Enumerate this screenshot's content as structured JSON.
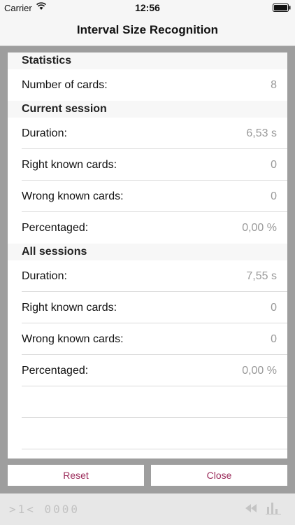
{
  "status_bar": {
    "carrier": "Carrier",
    "time": "12:56"
  },
  "nav": {
    "title": "Interval Size Recognition"
  },
  "statistics": {
    "header": "Statistics",
    "rows": [
      {
        "label": "Number of cards:",
        "value": "8"
      }
    ]
  },
  "current_session": {
    "header": "Current session",
    "rows": [
      {
        "label": "Duration:",
        "value": "6,53 s"
      },
      {
        "label": "Right known cards:",
        "value": "0"
      },
      {
        "label": "Wrong known cards:",
        "value": "0"
      },
      {
        "label": "Percentaged:",
        "value": "0,00 %"
      }
    ]
  },
  "all_sessions": {
    "header": "All sessions",
    "rows": [
      {
        "label": "Duration:",
        "value": "7,55 s"
      },
      {
        "label": "Right known cards:",
        "value": "0"
      },
      {
        "label": "Wrong known cards:",
        "value": "0"
      },
      {
        "label": "Percentaged:",
        "value": "0,00 %"
      }
    ]
  },
  "buttons": {
    "reset": "Reset",
    "close": "Close"
  },
  "toolbar": {
    "progress": ">1< 0000"
  },
  "colors": {
    "accent": "#9b2b5a",
    "background": "#9e9e9e"
  }
}
